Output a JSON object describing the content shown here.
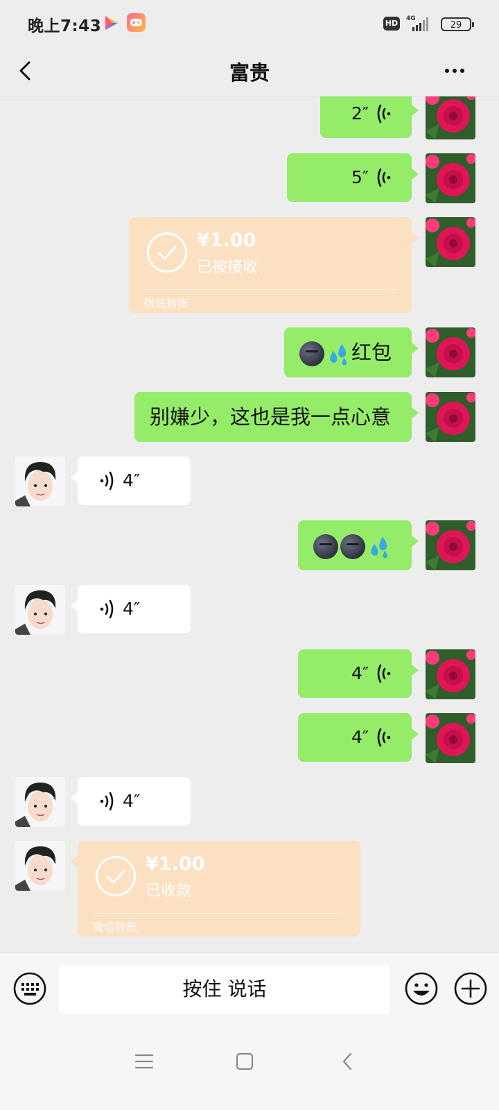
{
  "status_bar": {
    "time": "晚上7:43",
    "hd_label": "HD",
    "network": "4G",
    "battery": "29",
    "icons": [
      "play-store-icon",
      "game-center-icon",
      "hd-icon",
      "signal-icon",
      "battery-icon"
    ]
  },
  "header": {
    "title": "富贵",
    "back_icon": "chevron-left-icon",
    "more_icon": "more-icon"
  },
  "messages": [
    {
      "side": "right",
      "type": "voice",
      "duration": "2″"
    },
    {
      "side": "right",
      "type": "voice",
      "duration": "5″"
    },
    {
      "side": "right",
      "type": "transfer",
      "amount": "¥1.00",
      "status": "已被接收",
      "footer": "微信转账"
    },
    {
      "side": "right",
      "type": "text",
      "text": "红包",
      "emoji_prefix": [
        "new-moon-face",
        "sweat-droplets"
      ]
    },
    {
      "side": "right",
      "type": "text",
      "text": "别嫌少，这也是我一点心意"
    },
    {
      "side": "left",
      "type": "voice",
      "duration": "4″"
    },
    {
      "side": "right",
      "type": "emoji",
      "emojis": [
        "new-moon-face",
        "new-moon-face",
        "sweat-droplets"
      ]
    },
    {
      "side": "left",
      "type": "voice",
      "duration": "4″"
    },
    {
      "side": "right",
      "type": "voice",
      "duration": "4″"
    },
    {
      "side": "right",
      "type": "voice",
      "duration": "4″"
    },
    {
      "side": "left",
      "type": "voice",
      "duration": "4″"
    },
    {
      "side": "left",
      "type": "transfer",
      "amount": "¥1.00",
      "status": "已收款",
      "footer": "微信转账"
    }
  ],
  "input_bar": {
    "hold_to_talk": "按住 说话",
    "icons": [
      "keyboard-icon",
      "emoji-icon",
      "plus-icon"
    ]
  },
  "system_nav": {
    "icons": [
      "menu-icon",
      "home-icon",
      "back-icon"
    ]
  },
  "colors": {
    "background": "#ededed",
    "sent_bubble": "#95ec69",
    "received_bubble": "#ffffff",
    "transfer_bubble": "#fbe0c2"
  }
}
